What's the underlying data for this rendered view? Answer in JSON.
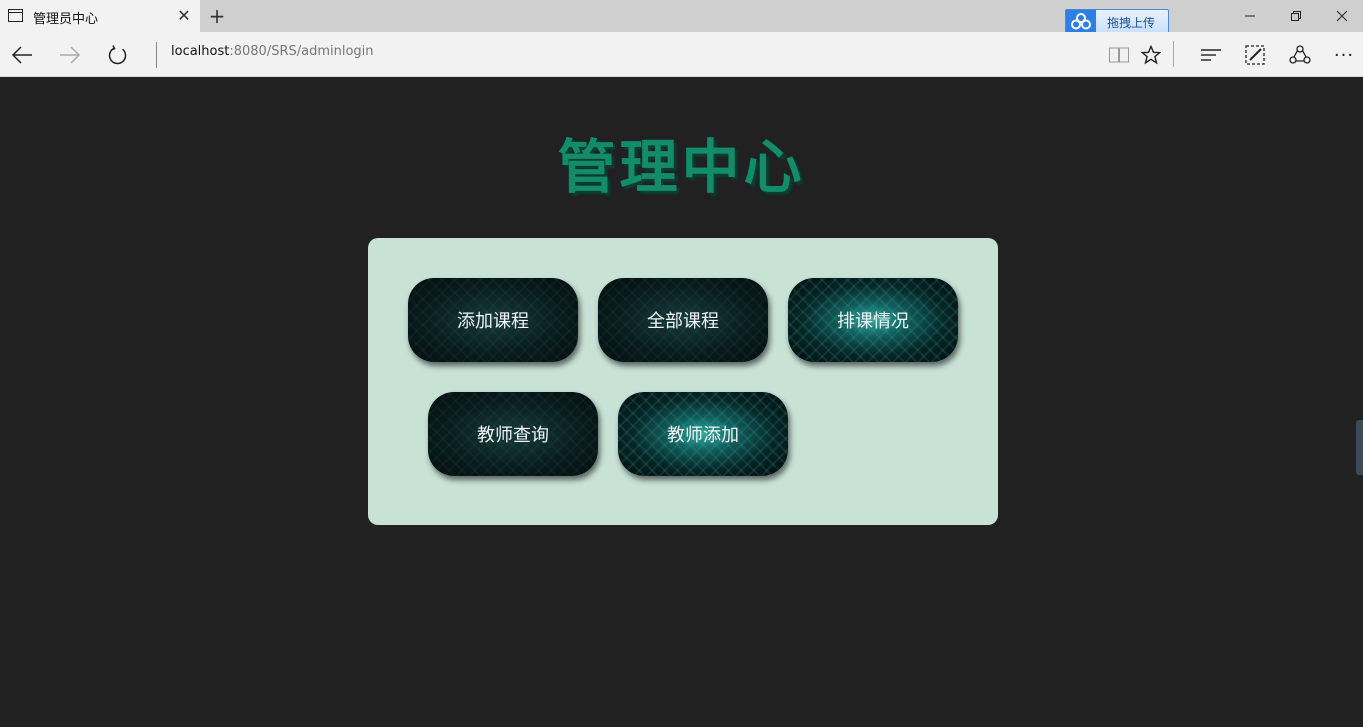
{
  "browser": {
    "tab_title": "管理员中心",
    "url_host": "localhost",
    "url_path": ":8080/SRS/adminlogin",
    "extension_label": "拖拽上传",
    "more_label": "···"
  },
  "page": {
    "title": "管理中心",
    "buttons": [
      {
        "label": "添加课程"
      },
      {
        "label": "全部课程"
      },
      {
        "label": "排课情况"
      },
      {
        "label": "教师查询"
      },
      {
        "label": "教师添加"
      }
    ]
  },
  "colors": {
    "page_background": "#202120",
    "title": "#138c6a",
    "panel": "#c8e2d6",
    "button_text": "#f4f4f4"
  },
  "icons": [
    "browser-tab-icon",
    "close-icon",
    "plus-icon",
    "back-arrow-icon",
    "forward-arrow-icon",
    "refresh-icon",
    "reading-view-icon",
    "star-icon",
    "hub-icon",
    "web-note-icon",
    "share-icon",
    "more-icon",
    "cloud-icon"
  ]
}
